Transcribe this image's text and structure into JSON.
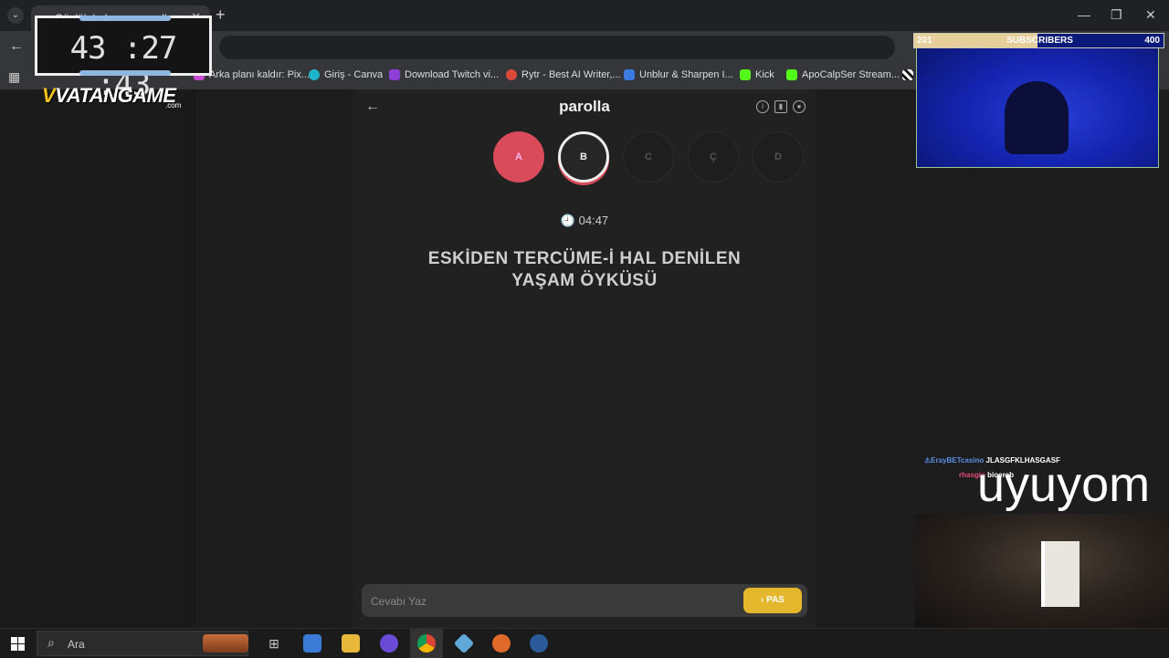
{
  "browser": {
    "tab_title": "Günlük bulmaca: parolla",
    "new_tab": "+",
    "window_controls": [
      "—",
      "❐",
      "✕"
    ],
    "bookmarks": [
      {
        "label": "Arka planı kaldır: Pix...",
        "color": "#c94bd1"
      },
      {
        "label": "Giriş - Canva",
        "color": "#1fb3c9"
      },
      {
        "label": "Download Twitch vi...",
        "color": "#8e3fd8"
      },
      {
        "label": "Rytr - Best AI Writer,...",
        "color": "#d94a3a"
      },
      {
        "label": "Unblur & Sharpen I...",
        "color": "#3b7be0"
      },
      {
        "label": "Kick",
        "color": "#53fc18"
      },
      {
        "label": "ApoCalpSer Stream...",
        "color": "#53fc18"
      }
    ]
  },
  "game": {
    "title": "parolla",
    "letters": [
      {
        "label": "A",
        "state": "done"
      },
      {
        "label": "B",
        "state": "active"
      },
      {
        "label": "C",
        "state": "pending"
      },
      {
        "label": "Ç",
        "state": "pending"
      },
      {
        "label": "D",
        "state": "pending"
      }
    ],
    "timer": "04:47",
    "question_line1": "ESKİDEN TERCÜME-İ HAL DENİLEN",
    "question_line2": "YAŞAM ÖYKÜSÜ",
    "answer_placeholder": "Cevabı Yaz",
    "pas_label": "PAS"
  },
  "overlay": {
    "clock": "43 :27 :43",
    "brand": "VATANGAME",
    "brand_sub": ".com",
    "subs_min": "201",
    "subs_label": "SUBSCRIBERS",
    "subs_max": "400",
    "chat": [
      {
        "user": "ErayBETcasino",
        "message": "JLASGFKLHASGASF",
        "color": "#5d8fe6"
      },
      {
        "user": "rhasgio",
        "message": "bioerab",
        "color": "#e04a74"
      }
    ],
    "status_text": "uyuyom"
  },
  "taskbar": {
    "search_label": "Ara"
  }
}
